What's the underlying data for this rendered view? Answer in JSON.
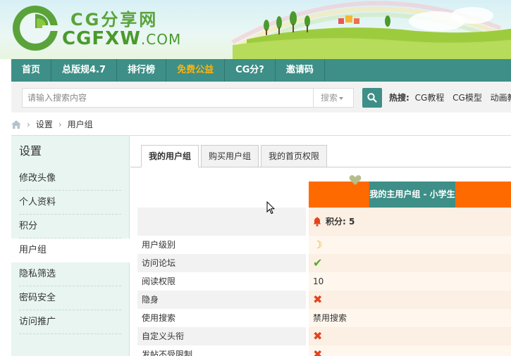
{
  "header": {
    "logo_cn": "CG分享网",
    "logo_en": "CGFXW",
    "logo_domain": ".COM",
    "brand_color": "#4a9a2c"
  },
  "nav": {
    "items": [
      {
        "label": "首页"
      },
      {
        "label": "总版规4.7"
      },
      {
        "label": "排行榜"
      },
      {
        "label": "免费公益",
        "highlight": true
      },
      {
        "label": "CG分?"
      },
      {
        "label": "邀请码"
      }
    ],
    "bg_color": "#3d8f87",
    "highlight_color": "#ffb20d"
  },
  "search": {
    "placeholder": "请输入搜索内容",
    "type_label": "搜索",
    "hot_label": "热搜:",
    "hot_links": [
      "CG教程",
      "CG模型",
      "动画教程"
    ]
  },
  "breadcrumb": {
    "items": [
      "设置",
      "用户组"
    ]
  },
  "sidebar": {
    "title": "设置",
    "items": [
      {
        "label": "修改头像"
      },
      {
        "label": "个人资料"
      },
      {
        "label": "积分"
      },
      {
        "label": "用户组",
        "active": true
      },
      {
        "label": "隐私筛选"
      },
      {
        "label": "密码安全"
      },
      {
        "label": "访问推广"
      }
    ]
  },
  "tabs": [
    {
      "label": "我的用户组",
      "active": true
    },
    {
      "label": "购买用户组"
    },
    {
      "label": "我的首页权限"
    }
  ],
  "group": {
    "name": "我的主用户组 - 小学生",
    "score_label": "积分: 5"
  },
  "permissions": [
    {
      "label": "用户级别",
      "value_type": "moon-icon",
      "value": ""
    },
    {
      "label": "访问论坛",
      "value_type": "check-icon",
      "value": ""
    },
    {
      "label": "阅读权限",
      "value_type": "text",
      "value": "10"
    },
    {
      "label": "隐身",
      "value_type": "cross-icon",
      "value": ""
    },
    {
      "label": "使用搜索",
      "value_type": "text",
      "value": "禁用搜索"
    },
    {
      "label": "自定义头衔",
      "value_type": "cross-icon",
      "value": ""
    },
    {
      "label": "发帖不受限制",
      "value_type": "cross-icon",
      "value": ""
    }
  ],
  "colors": {
    "orange": "#ff6a00",
    "teal": "#3d8f87",
    "cross": "#e5431b",
    "check": "#58a82a"
  }
}
